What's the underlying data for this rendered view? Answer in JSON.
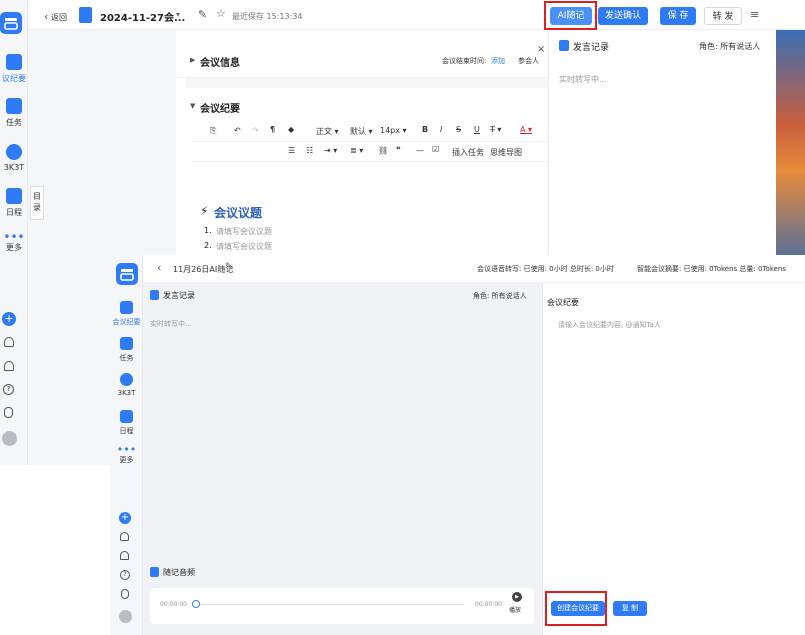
{
  "back": {
    "rail": [
      {
        "label": "议纪要",
        "color": "#2f7bf5"
      },
      {
        "label": "任务",
        "color": "#333333"
      },
      {
        "label": "3K3T",
        "color": "#333333"
      },
      {
        "label": "日程",
        "color": "#333333"
      },
      {
        "label": "更多",
        "color": "#333333"
      }
    ],
    "topbar": {
      "back_label": "返回",
      "doc_title": "2024-11-27会...",
      "saved": "最近保存 15:13:34",
      "ai_btn": "AI随记",
      "send_btn": "发送确认",
      "save_btn": "保 存",
      "forward_btn": "转 发"
    },
    "doc": {
      "section1": "会议信息",
      "end_time_label": "会议结束时间:",
      "add_link": "添加",
      "participants": "参会人",
      "section2": "会议纪要",
      "toolbar": {
        "style": "正文",
        "font": "默认",
        "size": "14px",
        "insert_task": "插入任务",
        "mindmap": "思维导图"
      },
      "heading": "会议议题",
      "items": [
        "请填写会议议题",
        "请填写会议议题"
      ]
    },
    "side_tab": "目录",
    "right": {
      "title": "发言记录",
      "role": "角色: 所有说话人",
      "status": "实时转写中..."
    }
  },
  "front": {
    "rail": [
      {
        "label": "会议纪要",
        "color": "#2f7bf5"
      },
      {
        "label": "任务",
        "color": "#333333"
      },
      {
        "label": "3K3T",
        "color": "#333333"
      },
      {
        "label": "日程",
        "color": "#333333"
      },
      {
        "label": "更多",
        "color": "#333333"
      }
    ],
    "topbar": {
      "title": "11月26日AI随记",
      "voice_usage": "会议语音转写: 已使用: 0小时 总时长: 0小时",
      "summary_usage": "智能会议摘要: 已使用: 0Tokens 总量: 0Tokens"
    },
    "left": {
      "title": "发言记录",
      "role": "角色: 所有说话人",
      "status": "实时转写中...",
      "audio_title": "随记音频",
      "time_start": "00:00:00",
      "time_end": "00:00:00",
      "play": "播放"
    },
    "right": {
      "title": "会议纪要",
      "placeholder": "请输入会议纪要内容, @通知Ta人",
      "create_btn": "创建会议纪要",
      "copy_btn": "复 制"
    }
  },
  "colors": {
    "primary": "#2f7bf5",
    "highlight": "#e02020"
  }
}
